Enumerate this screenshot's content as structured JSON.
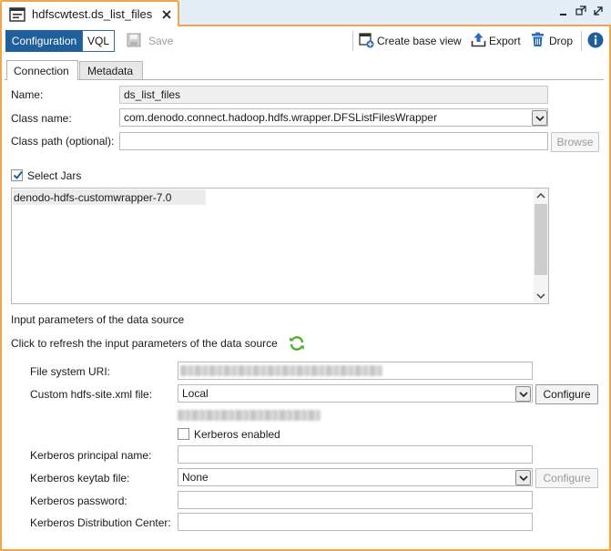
{
  "window": {
    "tab_title": "hdfscwtest.ds_list_files"
  },
  "toolbar": {
    "configuration_label": "Configuration",
    "vql_label": "VQL",
    "save_label": "Save",
    "create_base_view_label": "Create base view",
    "export_label": "Export",
    "drop_label": "Drop"
  },
  "tabs": [
    {
      "label": "Connection",
      "selected": true
    },
    {
      "label": "Metadata",
      "selected": false
    }
  ],
  "form": {
    "name_label": "Name:",
    "name_value": "ds_list_files",
    "class_name_label": "Class name:",
    "class_name_value": "com.denodo.connect.hadoop.hdfs.wrapper.DFSListFilesWrapper",
    "class_path_label": "Class path (optional):",
    "class_path_value": "",
    "browse_label": "Browse",
    "select_jars_label": "Select Jars",
    "select_jars_checked": true,
    "jars": [
      "denodo-hdfs-customwrapper-7.0"
    ]
  },
  "input_params": {
    "section_title": "Input parameters of the data source",
    "refresh_text": "Click to refresh the input parameters of the data source",
    "file_system_uri_label": "File system URI:",
    "custom_hdfs_site_label": "Custom hdfs-site.xml file:",
    "custom_hdfs_site_value": "Local",
    "configure_label": "Configure",
    "kerberos_enabled_label": "Kerberos enabled",
    "kerberos_enabled_checked": false,
    "kerberos_principal_label": "Kerberos principal name:",
    "kerberos_keytab_label": "Kerberos keytab file:",
    "kerberos_keytab_value": "None",
    "kerberos_configure_label": "Configure",
    "kerberos_password_label": "Kerberos password:",
    "kerberos_kdc_label": "Kerberos Distribution Center:"
  },
  "colors": {
    "accent_orange": "#f0a64a",
    "selected_segment": "#1f5f9c",
    "titlebar_bg": "#e4eef7",
    "refresh_green": "#4caf2a"
  }
}
